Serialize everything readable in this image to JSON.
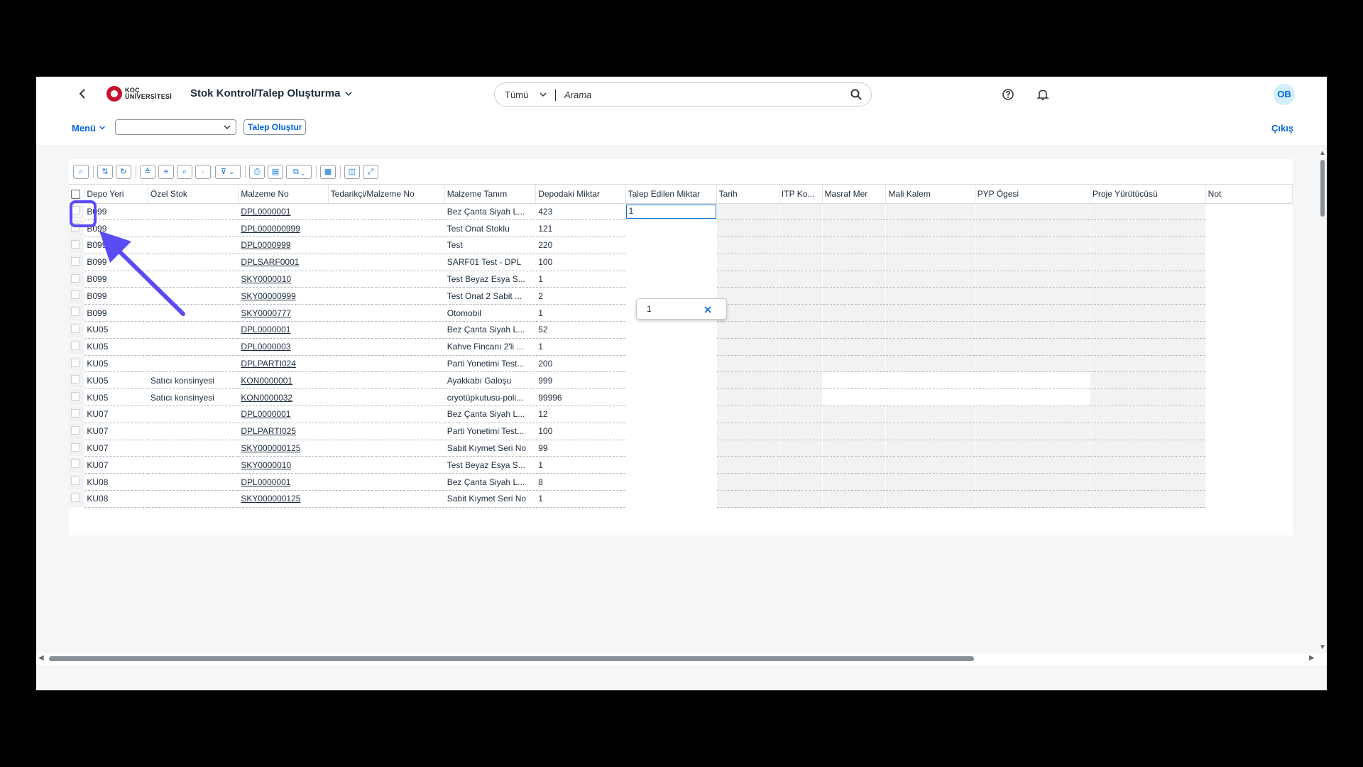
{
  "shell": {
    "back_icon": "chevron-left-icon",
    "logo_text_1": "KOÇ",
    "logo_text_2": "ÜNİVERSİTESİ",
    "app_title": "Stok Kontrol/Talep Oluşturma",
    "search_scope": "Tümü",
    "search_placeholder": "Arama",
    "avatar_initials": "OB"
  },
  "subbar": {
    "menu_label": "Menü",
    "select_value": "",
    "create_button": "Talep Oluştur",
    "logout": "Çıkış"
  },
  "table": {
    "columns": [
      "Depo Yeri",
      "Özel Stok",
      "Malzeme No",
      "Tedarikçi/Malzeme No",
      "Malzeme Tanım",
      "Depodaki Miktar",
      "Talep Edilen Miktar",
      "Tarih",
      "ITP Ko...",
      "Masraf Mer",
      "Mali Kalem",
      "PYP Ögesi",
      "Proje Yürütücüsü",
      "Not"
    ],
    "rows": [
      {
        "depo": "B099",
        "ozel": "",
        "malzeme_no": "DPL0000001",
        "tedarikci": "",
        "tanim": "Bez Çanta Siyah L...",
        "miktar": "423"
      },
      {
        "depo": "B099",
        "ozel": "",
        "malzeme_no": "DPL000000999",
        "tedarikci": "",
        "tanim": "Test Onat Stoklu",
        "miktar": "121"
      },
      {
        "depo": "B099",
        "ozel": "",
        "malzeme_no": "DPL0000999",
        "tedarikci": "",
        "tanim": "Test",
        "miktar": "220"
      },
      {
        "depo": "B099",
        "ozel": "",
        "malzeme_no": "DPLSARF0001",
        "tedarikci": "",
        "tanim": "SARF01 Test - DPL",
        "miktar": "100"
      },
      {
        "depo": "B099",
        "ozel": "",
        "malzeme_no": "SKY0000010",
        "tedarikci": "",
        "tanim": "Test Beyaz Esya S...",
        "miktar": "1"
      },
      {
        "depo": "B099",
        "ozel": "",
        "malzeme_no": "SKY00000999",
        "tedarikci": "",
        "tanim": "Test Onat 2 Sabit ...",
        "miktar": "2"
      },
      {
        "depo": "B099",
        "ozel": "",
        "malzeme_no": "SKY0000777",
        "tedarikci": "",
        "tanim": "Otomobil",
        "miktar": "1"
      },
      {
        "depo": "KU05",
        "ozel": "",
        "malzeme_no": "DPL0000001",
        "tedarikci": "",
        "tanim": "Bez Çanta Siyah L...",
        "miktar": "52"
      },
      {
        "depo": "KU05",
        "ozel": "",
        "malzeme_no": "DPL0000003",
        "tedarikci": "",
        "tanim": "Kahve Fincanı 2'li ...",
        "miktar": "1"
      },
      {
        "depo": "KU05",
        "ozel": "",
        "malzeme_no": "DPLPARTI024",
        "tedarikci": "",
        "tanim": "Parti Yonetimi Test...",
        "miktar": "200"
      },
      {
        "depo": "KU05",
        "ozel": "Satıcı konsinyesi",
        "malzeme_no": "KON0000001",
        "tedarikci": "",
        "tanim": "Ayakkabı Galoşu",
        "miktar": "999"
      },
      {
        "depo": "KU05",
        "ozel": "Satıcı konsinyesi",
        "malzeme_no": "KON0000032",
        "tedarikci": "",
        "tanim": "cryotüpkutusu-poli...",
        "miktar": "99996"
      },
      {
        "depo": "KU07",
        "ozel": "",
        "malzeme_no": "DPL0000001",
        "tedarikci": "",
        "tanim": "Bez Çanta Siyah L...",
        "miktar": "12"
      },
      {
        "depo": "KU07",
        "ozel": "",
        "malzeme_no": "DPLPARTI025",
        "tedarikci": "",
        "tanim": "Parti Yonetimi Test...",
        "miktar": "100"
      },
      {
        "depo": "KU07",
        "ozel": "",
        "malzeme_no": "SKY000000125",
        "tedarikci": "",
        "tanim": "Sabit Kıymet Seri No",
        "miktar": "99"
      },
      {
        "depo": "KU07",
        "ozel": "",
        "malzeme_no": "SKY0000010",
        "tedarikci": "",
        "tanim": "Test Beyaz Esya S...",
        "miktar": "1"
      },
      {
        "depo": "KU08",
        "ozel": "",
        "malzeme_no": "DPL0000001",
        "tedarikci": "",
        "tanim": "Bez Çanta Siyah L...",
        "miktar": "8"
      },
      {
        "depo": "KU08",
        "ozel": "",
        "malzeme_no": "SKY000000125",
        "tedarikci": "",
        "tanim": "Sabit Kıymet Seri No",
        "miktar": "1"
      }
    ],
    "active_input_value": "1",
    "suggestion_value": "1"
  },
  "colors": {
    "accent": "#0064d9",
    "annotation": "#5b4bf5"
  }
}
